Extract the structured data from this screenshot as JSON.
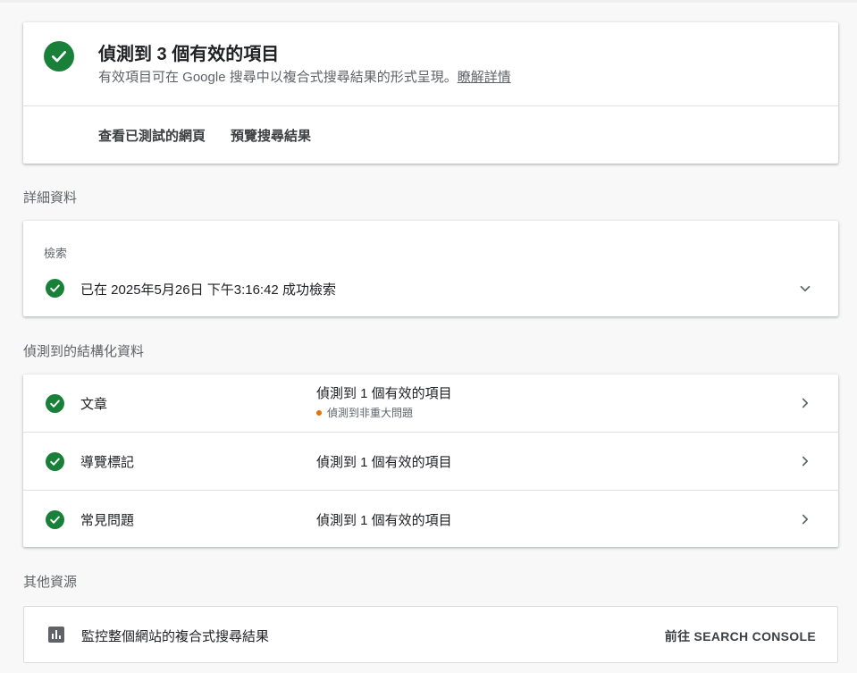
{
  "summary": {
    "title": "偵測到 3 個有效的項目",
    "subtitle": "有效項目可在 Google 搜尋中以複合式搜尋結果的形式呈現。",
    "learn_more": "瞭解詳情",
    "view_tested_page": "查看已測試的網頁",
    "preview_results": "預覽搜尋結果"
  },
  "details": {
    "heading": "詳細資料",
    "crawl_label": "檢索",
    "crawl_status": "已在 2025年5月26日 下午3:16:42 成功檢索"
  },
  "structured": {
    "heading": "偵測到的結構化資料",
    "items": [
      {
        "name": "文章",
        "status": "偵測到 1 個有效的項目",
        "warning": "偵測到非重大問題"
      },
      {
        "name": "導覽標記",
        "status": "偵測到 1 個有效的項目"
      },
      {
        "name": "常見問題",
        "status": "偵測到 1 個有效的項目"
      }
    ]
  },
  "other": {
    "heading": "其他資源",
    "monitor_text": "監控整個網站的複合式搜尋結果",
    "go_button": "前往 SEARCH CONSOLE"
  },
  "colors": {
    "success": "#188038",
    "warning": "#e37400",
    "text_primary": "#202124",
    "text_secondary": "#5f6368",
    "background": "#f8f8f8"
  },
  "icons": [
    "check-circle-icon",
    "chevron-down-icon",
    "chevron-right-icon",
    "bar-chart-icon"
  ]
}
